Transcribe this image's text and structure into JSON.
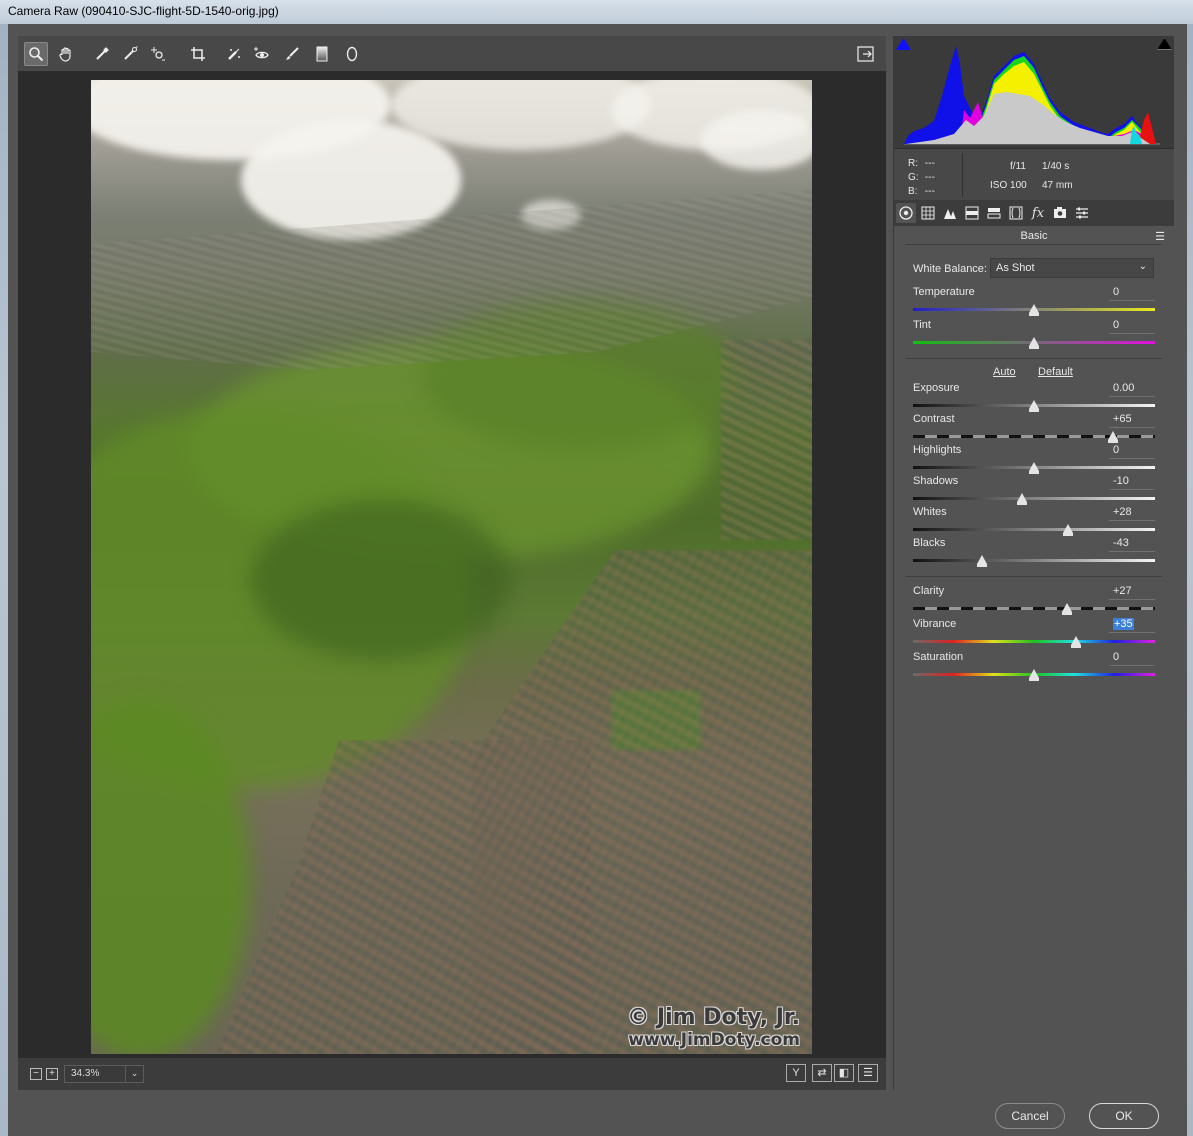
{
  "window": {
    "title": "Camera Raw (090410-SJC-flight-5D-1540-orig.jpg)"
  },
  "toolbar": {
    "tools": [
      {
        "name": "zoom-tool-icon",
        "glyph": "🔍"
      },
      {
        "name": "hand-tool-icon",
        "glyph": "✋"
      },
      {
        "name": "white-balance-tool-icon",
        "glyph": "⟋"
      },
      {
        "name": "color-sampler-tool-icon",
        "glyph": "⟋"
      },
      {
        "name": "targeted-adjustment-tool-icon",
        "glyph": "⊙"
      },
      {
        "name": "crop-tool-icon",
        "glyph": "⌗"
      },
      {
        "name": "spot-removal-tool-icon",
        "glyph": "⟋"
      },
      {
        "name": "red-eye-tool-icon",
        "glyph": "◉"
      },
      {
        "name": "adjustment-brush-icon",
        "glyph": "⟋"
      },
      {
        "name": "graduated-filter-icon",
        "glyph": "▮"
      },
      {
        "name": "radial-filter-icon",
        "glyph": "○"
      }
    ],
    "toggle_fullscreen_glyph": "⇲"
  },
  "photo": {
    "watermark_line1": "© Jim Doty, Jr.",
    "watermark_line2": "www.JimDoty.com"
  },
  "status": {
    "zoom_out": "−",
    "zoom_in": "+",
    "zoom_level": "34.3%",
    "zoom_dropdown": "⌄",
    "view_buttons": [
      "Y",
      "⇄",
      "◧",
      "☰"
    ]
  },
  "histogram": {
    "shadow_clip_color": "#1010ff",
    "highlight_clip_color": "#000000"
  },
  "readout": {
    "r_label": "R:",
    "r_value": "---",
    "g_label": "G:",
    "g_value": "---",
    "b_label": "B:",
    "b_value": "---",
    "aperture": "f/11",
    "shutter": "1/40 s",
    "iso": "ISO 100",
    "focal_length": "47 mm"
  },
  "tabs": [
    {
      "name": "tab-basic",
      "glyph": "◎"
    },
    {
      "name": "tab-tone-curve",
      "glyph": "▦"
    },
    {
      "name": "tab-detail",
      "glyph": "▲"
    },
    {
      "name": "tab-hsl",
      "glyph": "▤"
    },
    {
      "name": "tab-split-toning",
      "glyph": "▬"
    },
    {
      "name": "tab-lens-corrections",
      "glyph": "◫"
    },
    {
      "name": "tab-effects",
      "glyph": "fx"
    },
    {
      "name": "tab-camera-calibration",
      "glyph": "◙"
    },
    {
      "name": "tab-presets",
      "glyph": "☷"
    }
  ],
  "basic": {
    "title": "Basic",
    "menu_glyph": "☰",
    "white_balance_label": "White Balance:",
    "white_balance_value": "As Shot",
    "auto_label": "Auto",
    "default_label": "Default",
    "sliders": {
      "temperature": {
        "label": "Temperature",
        "value": "0",
        "position": 0.5
      },
      "tint": {
        "label": "Tint",
        "value": "0",
        "position": 0.5
      },
      "exposure": {
        "label": "Exposure",
        "value": "0.00",
        "position": 0.5
      },
      "contrast": {
        "label": "Contrast",
        "value": "+65",
        "position": 0.825
      },
      "highlights": {
        "label": "Highlights",
        "value": "0",
        "position": 0.5
      },
      "shadows": {
        "label": "Shadows",
        "value": "-10",
        "position": 0.45
      },
      "whites": {
        "label": "Whites",
        "value": "+28",
        "position": 0.64
      },
      "blacks": {
        "label": "Blacks",
        "value": "-43",
        "position": 0.285
      },
      "clarity": {
        "label": "Clarity",
        "value": "+27",
        "position": 0.635
      },
      "vibrance": {
        "label": "Vibrance",
        "value": "+35",
        "position": 0.675
      },
      "saturation": {
        "label": "Saturation",
        "value": "0",
        "position": 0.5
      }
    }
  },
  "footer": {
    "cancel_label": "Cancel",
    "ok_label": "OK"
  }
}
